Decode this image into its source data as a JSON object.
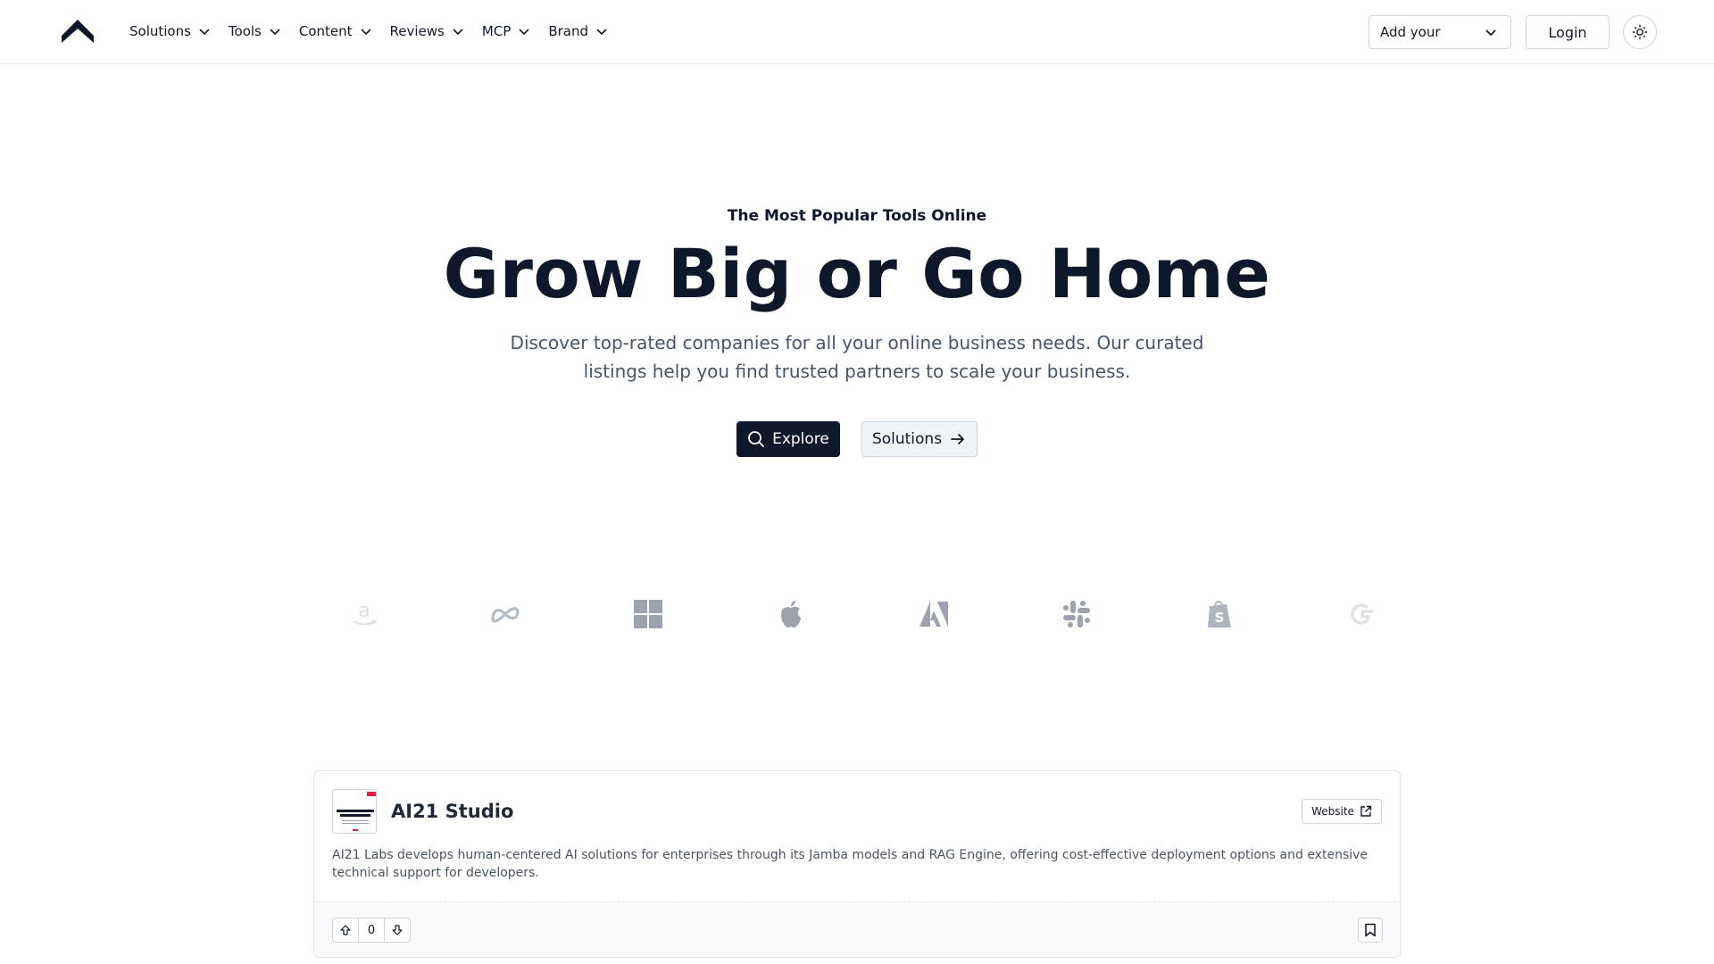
{
  "header": {
    "nav": [
      {
        "label": "Solutions"
      },
      {
        "label": "Tools"
      },
      {
        "label": "Content"
      },
      {
        "label": "Reviews"
      },
      {
        "label": "MCP"
      },
      {
        "label": "Brand"
      }
    ],
    "add_select_value": "Add your",
    "login_label": "Login"
  },
  "hero": {
    "eyebrow": "The Most Popular Tools Online",
    "title": "Grow Big or Go Home",
    "subtitle": "Discover top-rated companies for all your online business needs. Our curated listings help you find trusted partners to scale your business.",
    "explore_label": "Explore",
    "solutions_label": "Solutions"
  },
  "logos": [
    "amazon-logo",
    "meta-logo",
    "windows-logo",
    "apple-logo",
    "adobe-logo",
    "slack-logo",
    "shopify-logo",
    "google-logo"
  ],
  "card": {
    "title": "AI21 Studio",
    "website_label": "Website",
    "description": "AI21 Labs develops human-centered AI solutions for enterprises through its Jamba models and RAG Engine, offering cost-effective deployment options and extensive technical support for developers.",
    "vote_count": "0"
  },
  "colors": {
    "primary": "#0f172a",
    "muted_text": "#475569",
    "logo_gray": "#9ca3af"
  }
}
